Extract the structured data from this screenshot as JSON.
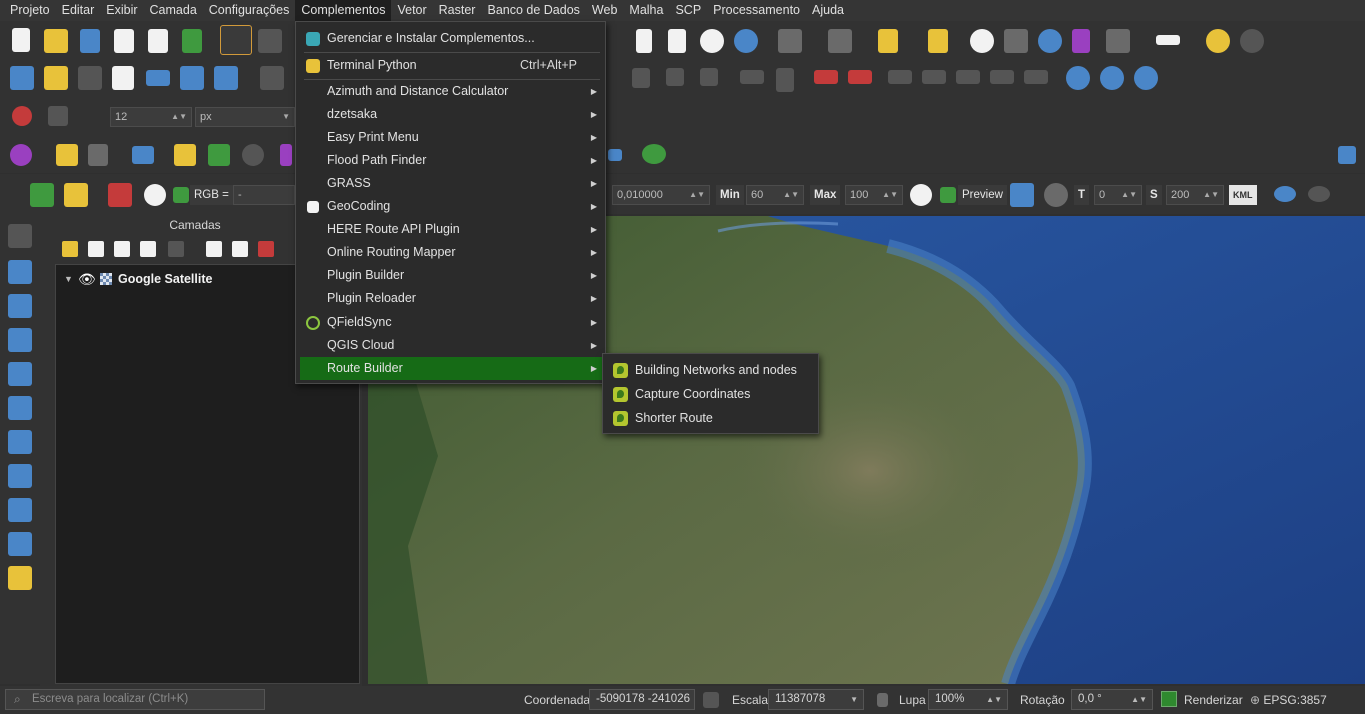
{
  "menubar": {
    "items": [
      "Projeto",
      "Editar",
      "Exibir",
      "Camada",
      "Configurações",
      "Complementos",
      "Vetor",
      "Raster",
      "Banco de Dados",
      "Web",
      "Malha",
      "SCP",
      "Processamento",
      "Ajuda"
    ],
    "active": "Complementos"
  },
  "toolbar": {
    "font_size_value": "12",
    "font_unit_value": "px",
    "rgb_label": "RGB =",
    "rgb_value": "-",
    "threshold_value": "0,010000",
    "min_label": "Min",
    "min_value": "60",
    "max_label": "Max",
    "max_value": "100",
    "preview_label": "Preview",
    "t_label": "T",
    "t_value": "0",
    "s_label": "S",
    "s_value": "200",
    "kml_label": "KML"
  },
  "layers": {
    "title": "Camadas",
    "items": [
      {
        "name": "Google Satellite",
        "visible": true
      }
    ]
  },
  "complementos_menu": {
    "items": [
      {
        "label": "Gerenciar e Instalar Complementos...",
        "icon": "puzzle-icon"
      },
      {
        "label": "Terminal Python",
        "shortcut": "Ctrl+Alt+P",
        "icon": "python-icon"
      },
      {
        "label": "Azimuth and Distance Calculator",
        "submenu": true
      },
      {
        "label": "dzetsaka",
        "submenu": true
      },
      {
        "label": "Easy Print Menu",
        "submenu": true
      },
      {
        "label": "Flood Path Finder",
        "submenu": true
      },
      {
        "label": "GRASS",
        "submenu": true
      },
      {
        "label": "GeoCoding",
        "submenu": true,
        "icon": "geocoding-icon"
      },
      {
        "label": "HERE Route API Plugin",
        "submenu": true
      },
      {
        "label": "Online Routing Mapper",
        "submenu": true
      },
      {
        "label": "Plugin Builder",
        "submenu": true
      },
      {
        "label": "Plugin Reloader",
        "submenu": true
      },
      {
        "label": "QFieldSync",
        "submenu": true,
        "icon": "qfield-icon"
      },
      {
        "label": "QGIS Cloud",
        "submenu": true
      },
      {
        "label": "Route Builder",
        "submenu": true,
        "highlighted": true
      }
    ]
  },
  "route_builder_submenu": {
    "items": [
      "Building Networks and nodes",
      "Capture Coordinates",
      "Shorter Route"
    ]
  },
  "statusbar": {
    "locator_placeholder": "Escreva para localizar (Ctrl+K)",
    "coord_label": "Coordenada",
    "coord_value": "-5090178 -241026",
    "scale_label": "Escala",
    "scale_value": "11387078",
    "magnifier_label": "Lupa",
    "magnifier_value": "100%",
    "rotation_label": "Rotação",
    "rotation_value": "0,0 °",
    "render_label": "Renderizar",
    "crs_label": "EPSG:3857"
  },
  "colors": {
    "menu_highlight": "#166b16",
    "background": "#2f2f2f",
    "ocean": "#234a8f"
  }
}
